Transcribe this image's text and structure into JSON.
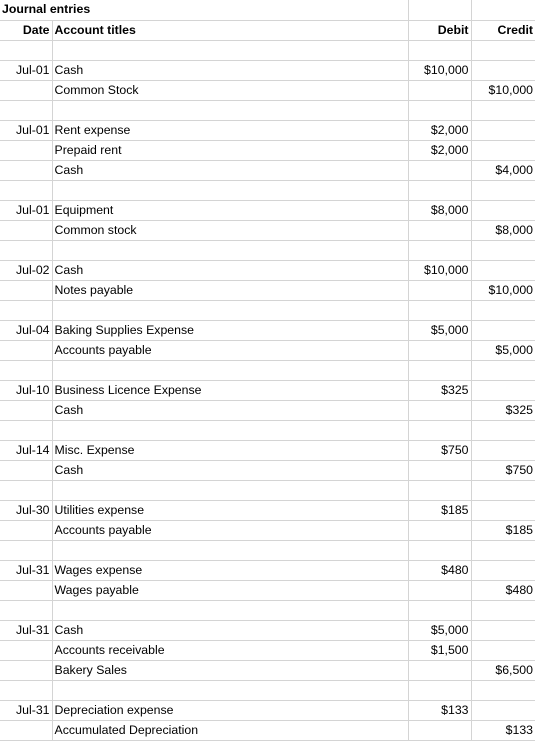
{
  "sheet": {
    "title": "Journal entries",
    "columns": {
      "date": "Date",
      "account": "Account titles",
      "debit": "Debit",
      "credit": "Credit"
    },
    "rows": [
      {
        "date": "",
        "account": "",
        "debit": "",
        "credit": ""
      },
      {
        "date": "Jul-01",
        "account": "Cash",
        "debit": "$10,000",
        "credit": ""
      },
      {
        "date": "",
        "account": "Common Stock",
        "debit": "",
        "credit": "$10,000"
      },
      {
        "date": "",
        "account": "",
        "debit": "",
        "credit": ""
      },
      {
        "date": "Jul-01",
        "account": "Rent expense",
        "debit": "$2,000",
        "credit": ""
      },
      {
        "date": "",
        "account": "Prepaid rent",
        "debit": "$2,000",
        "credit": ""
      },
      {
        "date": "",
        "account": "Cash",
        "debit": "",
        "credit": "$4,000"
      },
      {
        "date": "",
        "account": "",
        "debit": "",
        "credit": ""
      },
      {
        "date": "Jul-01",
        "account": "Equipment",
        "debit": "$8,000",
        "credit": ""
      },
      {
        "date": "",
        "account": "Common stock",
        "debit": "",
        "credit": "$8,000"
      },
      {
        "date": "",
        "account": "",
        "debit": "",
        "credit": ""
      },
      {
        "date": "Jul-02",
        "account": "Cash",
        "debit": "$10,000",
        "credit": ""
      },
      {
        "date": "",
        "account": "Notes payable",
        "debit": "",
        "credit": "$10,000"
      },
      {
        "date": "",
        "account": "",
        "debit": "",
        "credit": ""
      },
      {
        "date": "Jul-04",
        "account": "Baking Supplies Expense",
        "debit": "$5,000",
        "credit": ""
      },
      {
        "date": "",
        "account": "Accounts payable",
        "debit": "",
        "credit": "$5,000"
      },
      {
        "date": "",
        "account": "",
        "debit": "",
        "credit": ""
      },
      {
        "date": "Jul-10",
        "account": "Business Licence Expense",
        "debit": "$325",
        "credit": ""
      },
      {
        "date": "",
        "account": "Cash",
        "debit": "",
        "credit": "$325"
      },
      {
        "date": "",
        "account": "",
        "debit": "",
        "credit": ""
      },
      {
        "date": "Jul-14",
        "account": "Misc. Expense",
        "debit": "$750",
        "credit": ""
      },
      {
        "date": "",
        "account": "Cash",
        "debit": "",
        "credit": "$750"
      },
      {
        "date": "",
        "account": "",
        "debit": "",
        "credit": ""
      },
      {
        "date": "Jul-30",
        "account": "Utilities expense",
        "debit": "$185",
        "credit": ""
      },
      {
        "date": "",
        "account": "Accounts payable",
        "debit": "",
        "credit": "$185"
      },
      {
        "date": "",
        "account": "",
        "debit": "",
        "credit": ""
      },
      {
        "date": "Jul-31",
        "account": "Wages expense",
        "debit": "$480",
        "credit": ""
      },
      {
        "date": "",
        "account": "Wages payable",
        "debit": "",
        "credit": "$480"
      },
      {
        "date": "",
        "account": "",
        "debit": "",
        "credit": ""
      },
      {
        "date": "Jul-31",
        "account": "Cash",
        "debit": "$5,000",
        "credit": ""
      },
      {
        "date": "",
        "account": "Accounts receivable",
        "debit": "$1,500",
        "credit": ""
      },
      {
        "date": "",
        "account": "Bakery Sales",
        "debit": "",
        "credit": "$6,500"
      },
      {
        "date": "",
        "account": "",
        "debit": "",
        "credit": ""
      },
      {
        "date": "Jul-31",
        "account": "Depreciation expense",
        "debit": "$133",
        "credit": ""
      },
      {
        "date": "",
        "account": "Accumulated Depreciation",
        "debit": "",
        "credit": "$133"
      }
    ]
  }
}
